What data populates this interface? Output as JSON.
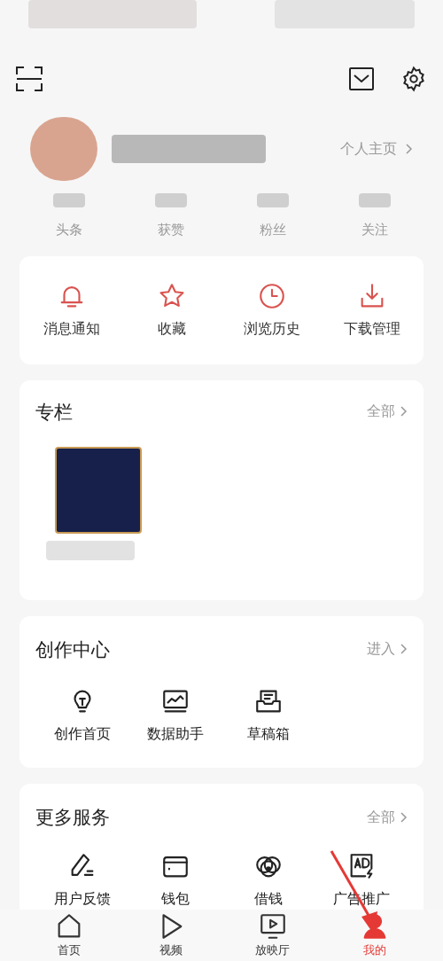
{
  "header": {
    "profile_link": "个人主页"
  },
  "stats": [
    {
      "label": "头条"
    },
    {
      "label": "获赞"
    },
    {
      "label": "粉丝"
    },
    {
      "label": "关注"
    }
  ],
  "quick_actions": [
    {
      "kind": "bell",
      "label": "消息通知"
    },
    {
      "kind": "star",
      "label": "收藏"
    },
    {
      "kind": "clock",
      "label": "浏览历史"
    },
    {
      "kind": "download",
      "label": "下载管理"
    }
  ],
  "column_section": {
    "title": "专栏",
    "link": "全部"
  },
  "creation_center": {
    "title": "创作中心",
    "link": "进入",
    "items": [
      {
        "kind": "bulb",
        "label": "创作首页"
      },
      {
        "kind": "chart",
        "label": "数据助手"
      },
      {
        "kind": "drafts",
        "label": "草稿箱"
      }
    ]
  },
  "more_services": {
    "title": "更多服务",
    "link": "全部",
    "items": [
      {
        "kind": "pen",
        "label": "用户反馈"
      },
      {
        "kind": "wallet",
        "label": "钱包"
      },
      {
        "kind": "coins",
        "label": "借钱"
      },
      {
        "kind": "ad",
        "label": "广告推广"
      }
    ]
  },
  "bottom_nav": [
    {
      "kind": "home",
      "label": "首页",
      "selected": false
    },
    {
      "kind": "play",
      "label": "视频",
      "selected": false
    },
    {
      "kind": "screen",
      "label": "放映厅",
      "selected": false
    },
    {
      "kind": "person",
      "label": "我的",
      "selected": true
    }
  ]
}
